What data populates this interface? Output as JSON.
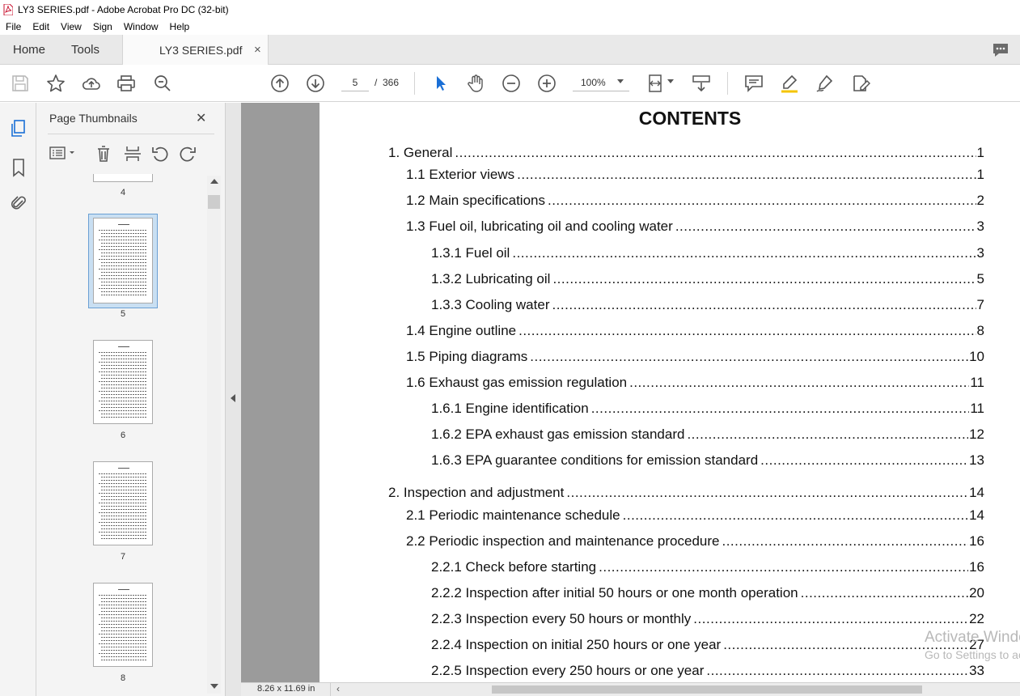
{
  "window": {
    "title": "LY3 SERIES.pdf - Adobe Acrobat Pro DC (32-bit)"
  },
  "menu": [
    "File",
    "Edit",
    "View",
    "Sign",
    "Window",
    "Help"
  ],
  "tabs": {
    "home": "Home",
    "tools": "Tools",
    "document": "LY3 SERIES.pdf",
    "close": "×"
  },
  "toolbar": {
    "page_current": "5",
    "page_sep": "/",
    "page_total": "366",
    "zoom": "100%"
  },
  "thumbnails": {
    "title": "Page Thumbnails",
    "close": "✕",
    "pages": [
      "4",
      "5",
      "6",
      "7",
      "8"
    ],
    "selected": "5"
  },
  "document": {
    "heading": "CONTENTS",
    "entries": [
      {
        "label": "1. General",
        "page": "1"
      },
      {
        "label": "1.1 Exterior views",
        "page": "1"
      },
      {
        "label": "1.2 Main specifications",
        "page": "2"
      },
      {
        "label": "1.3 Fuel oil, lubricating oil and cooling water",
        "page": "3"
      },
      {
        "label": "1.3.1 Fuel oil",
        "page": "3"
      },
      {
        "label": "1.3.2 Lubricating oil",
        "page": "5"
      },
      {
        "label": "1.3.3 Cooling water",
        "page": "7"
      },
      {
        "label": "1.4 Engine outline",
        "page": "8"
      },
      {
        "label": "1.5 Piping diagrams",
        "page": "10"
      },
      {
        "label": "1.6 Exhaust gas emission regulation",
        "page": "11"
      },
      {
        "label": "1.6.1 Engine identification",
        "page": "11"
      },
      {
        "label": "1.6.2 EPA exhaust gas emission standard",
        "page": "12"
      },
      {
        "label": "1.6.3 EPA guarantee conditions for emission standard",
        "page": "13"
      },
      {
        "label": "2. Inspection and adjustment",
        "page": "14"
      },
      {
        "label": "2.1 Periodic maintenance schedule",
        "page": "14"
      },
      {
        "label": "2.2 Periodic inspection and maintenance procedure",
        "page": "16"
      },
      {
        "label": "2.2.1 Check before starting",
        "page": "16"
      },
      {
        "label": "2.2.2 Inspection after initial 50 hours or one month operation",
        "page": "20"
      },
      {
        "label": "2.2.3 Inspection every 50 hours or monthly",
        "page": "22"
      },
      {
        "label": "2.2.4 Inspection on initial 250 hours or one year",
        "page": "27"
      },
      {
        "label": "2.2.5 Inspection every 250 hours or one year",
        "page": "33"
      }
    ]
  },
  "status": {
    "page_size": "8.26 x 11.69 in"
  },
  "watermark": {
    "line1": "Activate Windows",
    "line2": "Go to Settings to activate Windows."
  }
}
